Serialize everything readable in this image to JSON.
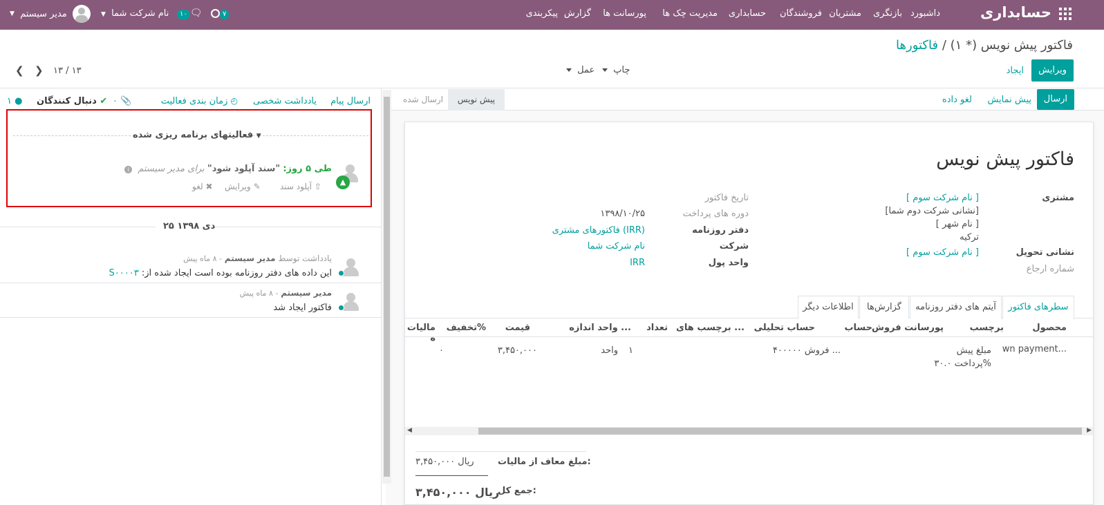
{
  "topbar": {
    "app_name": "حسابداری",
    "menu": [
      "داشبورد",
      "بازنگری",
      "مشتریان",
      "فروشندگان",
      "حسابداری",
      "مدیریت چک ها",
      "پورسانت ها",
      "گزارش",
      "پیکربندی"
    ],
    "user_name": "مدیر سیستم",
    "company_name": "نام شرکت شما",
    "messages_count": "۱۰",
    "activities_count": "۷"
  },
  "breadcrumb": {
    "parent": "فاکتورها",
    "separator": "/",
    "current": "فاکتور پیش نویس (* ۱)"
  },
  "toolbar": {
    "edit_label": "ویرایش",
    "create_label": "ایجاد",
    "print_label": "چاپ",
    "action_label": "عمل",
    "pager": "۱۳ / ۱۳"
  },
  "statusbar": {
    "send_label": "ارسال",
    "preview_label": "پیش نمایش",
    "cancel_label": "لغو داده",
    "stage_draft": "پیش نویس",
    "stage_sent": "ارسال شده"
  },
  "sheet": {
    "title": "فاکتور پیش نویس",
    "customer_label": "مشتری",
    "customer_lines": [
      "[ نام شرکت سوم ]",
      "[نشانی شرکت دوم شما]",
      "[ نام شهر ]",
      "ترکیه"
    ],
    "delivery_label": "نشانی تحویل",
    "delivery_value": "[ نام شرکت سوم ]",
    "reference_label": "شماره ارجاع",
    "invoice_date_label": "تاریخ فاکتور",
    "payment_term_label": "دوره های پرداخت",
    "payment_term_value": "۱۳۹۸/۱۰/۲۵",
    "journal_label": "دفتر روزنامه",
    "journal_value": "فاکتورهای مشتری (IRR)",
    "company_label": "شرکت",
    "company_value": "نام شرکت شما",
    "currency_label": "واحد پول",
    "currency_value": "IRR"
  },
  "tabs": [
    "سطرهای فاکتور",
    "آیتم های دفتر روزنامه",
    "گزارش‌ها",
    "اطلاعات دیگر"
  ],
  "table": {
    "headers": [
      "محصول",
      "برچسب",
      "پورسانت فروش",
      "حساب",
      "حساب تحلیلی",
      "برچسب های ...",
      "تعداد",
      "واحد اندازه ...",
      "قیمت",
      "تخفیف%",
      "مالیات ه"
    ],
    "row": {
      "product": "wn payment...",
      "label_line1": "مبلغ پیش",
      "label_line2": "پرداخت ۳۰.۰%",
      "account": "۴۰۰۰۰۰ فروش ...",
      "quantity": "۱",
      "uom": "واحد",
      "price": "۳,۴۵۰,۰۰۰",
      "discount": "۰"
    }
  },
  "totals": {
    "untaxed_label": "مبلغ معاف از مالیات:",
    "untaxed_value": "۳,۴۵۰,۰۰۰ ریال",
    "total_label": "جمع کل:",
    "total_value": "۳,۴۵۰,۰۰۰ ریال"
  },
  "chatter": {
    "send_message": "ارسال پیام",
    "log_note": "یادداشت شخصی",
    "schedule_activity": "زمان بندی فعالیت",
    "attachments_count": "۰",
    "follow_label": "دنبال کنندگان",
    "followers_count": "۱",
    "planned_header": "فعالیتهای برنامه ریزی شده",
    "activity_due": "طی ۵ روز:",
    "activity_summary": "\"سند آپلود شود\"",
    "activity_for": "برای مدیر سیستم",
    "activity_upload": "آپلود سند",
    "activity_edit": "ویرایش",
    "activity_cancel": "لغو",
    "date_separator": "۲۵ دی ۱۳۹۸",
    "msg1_header_prefix": "یادداشت توسط",
    "msg1_author": "مدیر سیستم",
    "msg1_time": "- ۸ ماه پیش",
    "msg1_body_prefix": "این داده های دفتر روزنامه بوده است ایجاد شده از:",
    "msg1_link": "S۰۰۰۰۳",
    "msg2_author": "مدیر سیستم",
    "msg2_time": "- ۸ ماه پیش",
    "msg2_body": "فاکتور ایجاد شد"
  },
  "colors": {
    "brand": "#875a7b",
    "accent": "#00a09d",
    "highlight_border": "#e00000"
  }
}
